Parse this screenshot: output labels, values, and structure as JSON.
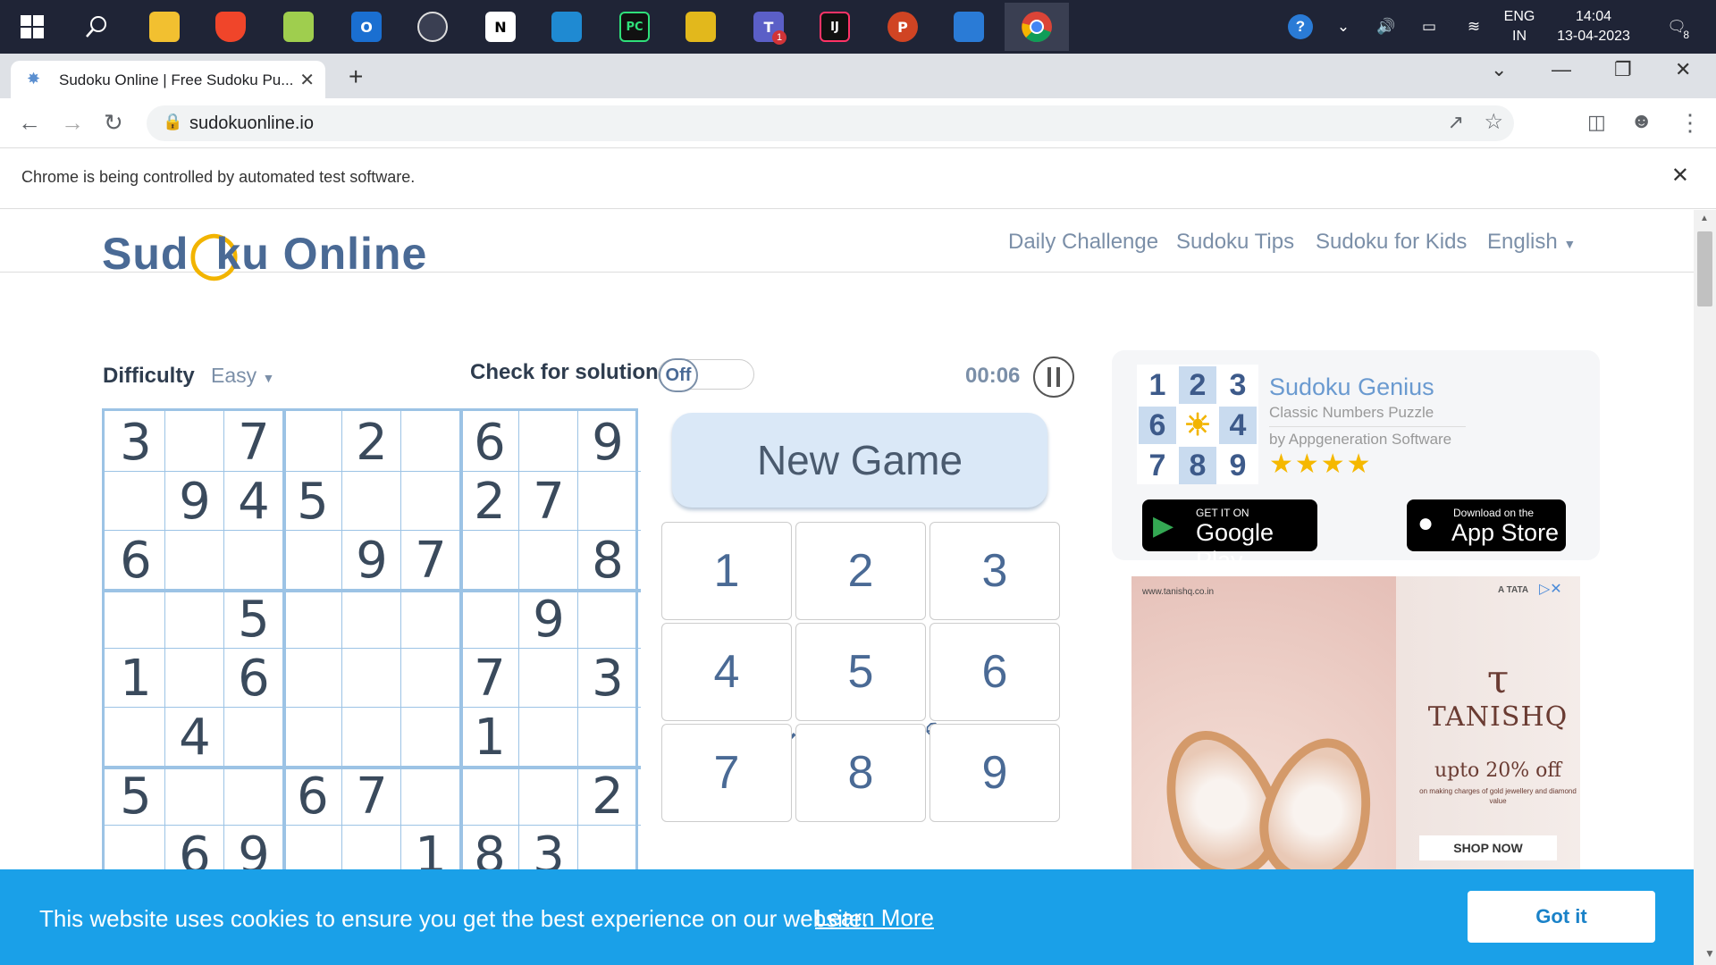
{
  "taskbar": {
    "apps": [
      "start-windows",
      "search",
      "file-explorer",
      "brave",
      "notepad-plus",
      "outlook",
      "terminal",
      "notion",
      "vscode",
      "pycharm",
      "git-kraken",
      "teams",
      "intellij",
      "powerpoint",
      "photos",
      "chrome"
    ],
    "teams_badge": "1",
    "language_top": "ENG",
    "language_bottom": "IN",
    "time": "14:04",
    "date": "13-04-2023",
    "notifications_count": "8"
  },
  "browser": {
    "tab_title": "Sudoku Online | Free Sudoku Pu...",
    "url": "sudokuonline.io",
    "infobar_text": "Chrome is being controlled by automated test software."
  },
  "site": {
    "logo_prefix": "Sud",
    "logo_suffix": "ku Online",
    "nav": [
      "Daily Challenge",
      "Sudoku Tips",
      "Sudoku for Kids",
      "English"
    ]
  },
  "game": {
    "difficulty_label": "Difficulty",
    "difficulty_value": "Easy",
    "check_label": "Check for solution:",
    "toggle_state": "Off",
    "timer": "00:06",
    "new_game_label": "New Game",
    "board": [
      [
        "3",
        "",
        "7",
        "",
        "2",
        "",
        "6",
        "",
        "9"
      ],
      [
        "",
        "9",
        "4",
        "5",
        "",
        "",
        "2",
        "7",
        ""
      ],
      [
        "6",
        "",
        "",
        "",
        "9",
        "7",
        "",
        "",
        "8"
      ],
      [
        "",
        "",
        "5",
        "",
        "",
        "",
        "",
        "9",
        ""
      ],
      [
        "1",
        "",
        "6",
        "",
        "",
        "",
        "7",
        "",
        "3"
      ],
      [
        "",
        "4",
        "",
        "",
        "",
        "",
        "1",
        "",
        ""
      ],
      [
        "5",
        "",
        "",
        "6",
        "7",
        "",
        "",
        "",
        "2"
      ],
      [
        "",
        "6",
        "9",
        "",
        "",
        "1",
        "8",
        "3",
        ""
      ]
    ],
    "numpad": [
      "1",
      "2",
      "3",
      "4",
      "5",
      "6",
      "7",
      "8",
      "9"
    ],
    "tools": [
      "undo-icon",
      "redo-icon",
      "eraser-icon",
      "pencil-icon",
      "hint-bulb-icon"
    ]
  },
  "app_promo": {
    "logo_digits": [
      "1",
      "2",
      "3",
      "6",
      "",
      "4",
      "7",
      "8",
      "9"
    ],
    "name": "Sudoku Genius",
    "subtitle": "Classic Numbers Puzzle",
    "by": "by Appgeneration Software",
    "stars": "★★★★",
    "google_small": "GET IT ON",
    "google_big": "Google Play",
    "apple_small": "Download on the",
    "apple_big": "App Store"
  },
  "ad": {
    "url": "www.tanishq.co.in",
    "tata": "A TATA",
    "brand": "TANISHQ",
    "offer": "upto 20% off",
    "offer_small": "on making charges of gold jewellery and diamond value",
    "cta": "SHOP NOW"
  },
  "cookie": {
    "text": "This website uses cookies to ensure you get the best experience on our website.",
    "link": "Learn More",
    "button": "Got it"
  },
  "colors": {
    "accent": "#4a6a95",
    "board_border": "#9cc3e5",
    "cookie_bg": "#1aa0e8",
    "taskbar_bg": "#1f2436"
  }
}
